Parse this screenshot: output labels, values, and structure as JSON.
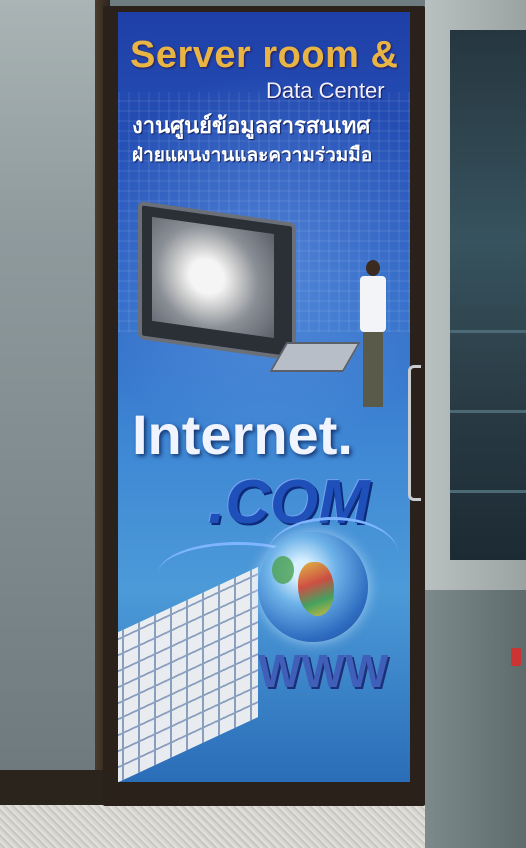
{
  "poster": {
    "title_en_line1": "Server room &",
    "title_en_line2": "Data Center",
    "title_th_line1": "งานศูนย์ข้อมูลสารสนเทศ",
    "title_th_line2": "ฝ่ายแผนงานและความร่วมมือ",
    "word_internet": "Internet.",
    "word_com": ".COM",
    "word_www": "WWW"
  },
  "colors": {
    "title_gold": "#e8b545",
    "poster_blue": "#2a5dc0",
    "door_frame": "#2a221a"
  }
}
